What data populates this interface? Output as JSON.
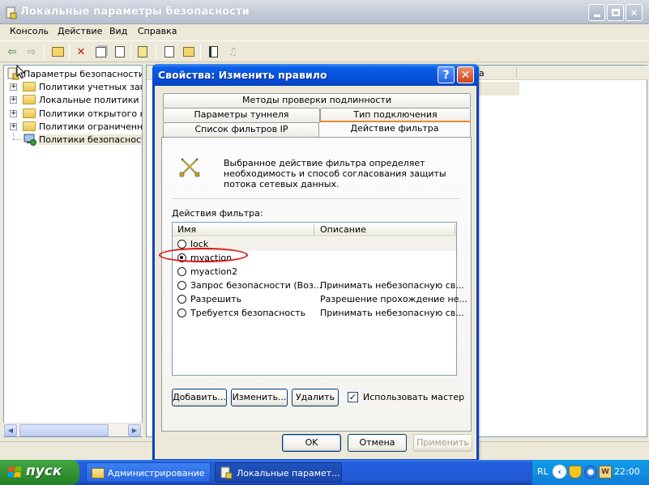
{
  "main_window": {
    "title": "Локальные параметры безопасности",
    "menu": [
      "Консоль",
      "Действие",
      "Вид",
      "Справка"
    ],
    "tree": {
      "root": "Параметры безопасности",
      "items": [
        {
          "label": "Политики учетных запис"
        },
        {
          "label": "Локальные политики"
        },
        {
          "label": "Политики открытого клю"
        },
        {
          "label": "Политики ограниченного"
        },
        {
          "label": "Политики безопасности I"
        }
      ]
    },
    "right_header": {
      "col3": "а"
    }
  },
  "dialog": {
    "title": "Свойства: Изменить правило",
    "tabs": {
      "row1": [
        "Методы проверки подлинности"
      ],
      "row2": [
        "Параметры туннеля",
        "Тип подключения"
      ],
      "row3": [
        "Список фильтров IP",
        "Действие фильтра"
      ]
    },
    "info_text": "Выбранное действие фильтра определяет необходимость и способ согласования защиты потока сетевых данных.",
    "list_label": "Действия фильтра:",
    "columns": [
      "Имя",
      "Описание"
    ],
    "rows": [
      {
        "name": "lock",
        "desc": "",
        "selected": false
      },
      {
        "name": "myaction",
        "desc": "",
        "selected": true
      },
      {
        "name": "myaction2",
        "desc": "",
        "selected": false
      },
      {
        "name": "Запрос безопасности (Воз...",
        "desc": "Принимать небезопасную св...",
        "selected": false
      },
      {
        "name": "Разрешить",
        "desc": "Разрешение прохождение не...",
        "selected": false
      },
      {
        "name": "Требуется безопасность",
        "desc": "Принимать небезопасную св...",
        "selected": false
      }
    ],
    "buttons": {
      "add": "Добавить...",
      "edit": "Изменить...",
      "delete": "Удалить",
      "use_wizard": "Использовать мастер",
      "use_wizard_checked": true,
      "ok": "OK",
      "cancel": "Отмена",
      "apply": "Применить"
    }
  },
  "taskbar": {
    "start": "пуск",
    "tasks": [
      "Администрирование",
      "Локальные парамет..."
    ],
    "lang": "RL",
    "clock": "22:00"
  },
  "colors": {
    "xp_blue": "#0550dc",
    "highlight_oval": "#e01010",
    "start_green": "#3a9a3a"
  }
}
